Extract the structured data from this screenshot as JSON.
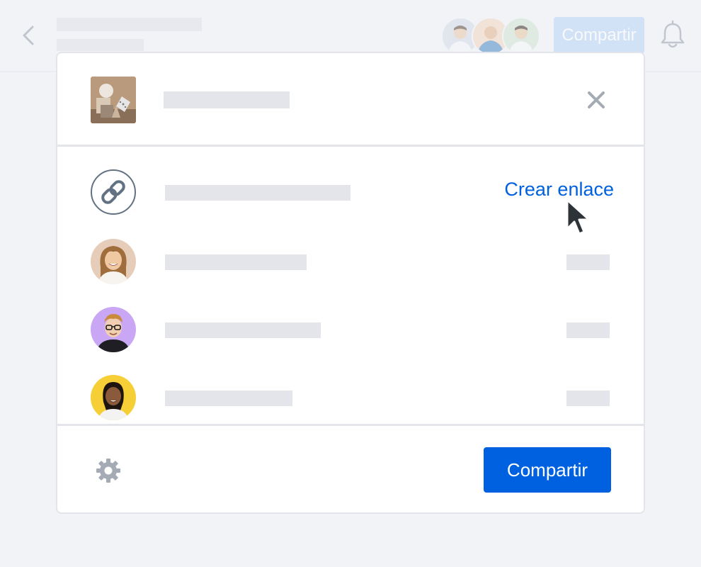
{
  "header": {
    "share_label": "Compartir"
  },
  "dialog": {
    "create_link_label": "Crear enlace",
    "share_label": "Compartir"
  },
  "colors": {
    "accent": "#0061e0",
    "accent_faded": "#b7d3f6",
    "placeholder": "#e4e5ea",
    "link_icon": "#637282"
  },
  "icons": [
    "back-chevron-icon",
    "bell-icon",
    "close-icon",
    "link-icon",
    "gear-icon",
    "mouse-pointer-icon"
  ]
}
